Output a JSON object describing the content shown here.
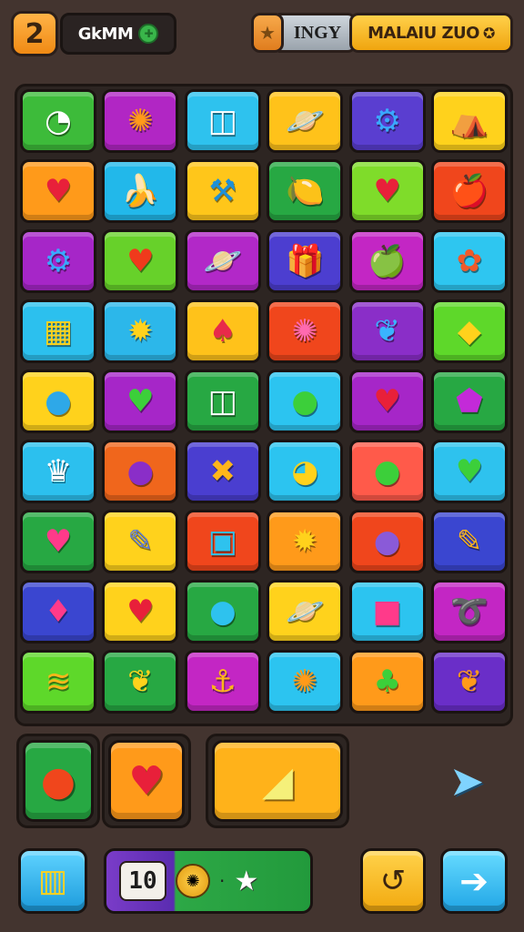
{
  "header": {
    "level": "2",
    "player_name": "GkMM",
    "tag": "INGY",
    "score_text": "MALAIU ZUO"
  },
  "board": {
    "rows": 9,
    "columns": 6,
    "tiles": [
      [
        {
          "color": "#3dbb3a",
          "icon": "pie-timer",
          "glyph": "◔",
          "fg": "#ffffff"
        },
        {
          "color": "#b126c4",
          "icon": "sun-gear",
          "glyph": "✺",
          "fg": "#ff9a1a"
        },
        {
          "color": "#2ec2ee",
          "icon": "cake-drum",
          "glyph": "◫",
          "fg": "#ffffff"
        },
        {
          "color": "#ffc21a",
          "icon": "planet",
          "glyph": "🪐",
          "fg": "#6b5cff"
        },
        {
          "color": "#5a3ed0",
          "icon": "blue-gear",
          "glyph": "⚙",
          "fg": "#3aa8ff"
        },
        {
          "color": "#ffd21c",
          "icon": "tent",
          "glyph": "⛺",
          "fg": "#2a6b9a"
        }
      ],
      [
        {
          "color": "#ff9a1a",
          "icon": "red-heart",
          "glyph": "♥",
          "fg": "#e8203a"
        },
        {
          "color": "#22b8ea",
          "icon": "banana",
          "glyph": "🍌",
          "fg": "#ffd21c"
        },
        {
          "color": "#ffc61a",
          "icon": "wrench",
          "glyph": "⚒",
          "fg": "#1e90d8"
        },
        {
          "color": "#27a843",
          "icon": "lemon",
          "glyph": "🍋",
          "fg": "#ffd21c"
        },
        {
          "color": "#7fdc2a",
          "icon": "strawberry",
          "glyph": "♥",
          "fg": "#e8203a"
        },
        {
          "color": "#f0461c",
          "icon": "apple",
          "glyph": "🍎",
          "fg": "#e8203a"
        }
      ],
      [
        {
          "color": "#a626c8",
          "icon": "blue-gear",
          "glyph": "⚙",
          "fg": "#3aa8ff"
        },
        {
          "color": "#67d12a",
          "icon": "heart",
          "glyph": "♥",
          "fg": "#f03a1c"
        },
        {
          "color": "#b228c8",
          "icon": "planet",
          "glyph": "🪐",
          "fg": "#4ac4ff"
        },
        {
          "color": "#4c3ed0",
          "icon": "gift-box",
          "glyph": "🎁",
          "fg": "#ff7a2a"
        },
        {
          "color": "#c326c4",
          "icon": "apple",
          "glyph": "🍏",
          "fg": "#ffe23a"
        },
        {
          "color": "#2ec6f0",
          "icon": "maple-leaf",
          "glyph": "✿",
          "fg": "#f05a2a"
        }
      ],
      [
        {
          "color": "#2cc0ee",
          "icon": "building",
          "glyph": "▦",
          "fg": "#ffd21c"
        },
        {
          "color": "#2cb7ea",
          "icon": "star-flower",
          "glyph": "✹",
          "fg": "#ffd21c"
        },
        {
          "color": "#ffc21a",
          "icon": "radish",
          "glyph": "♠",
          "fg": "#e82a4a"
        },
        {
          "color": "#f0461c",
          "icon": "crab",
          "glyph": "✺",
          "fg": "#ff6ab0"
        },
        {
          "color": "#8a2ec8",
          "icon": "leaf",
          "glyph": "❦",
          "fg": "#3ab4ff"
        },
        {
          "color": "#5ed82a",
          "icon": "cheese",
          "glyph": "◆",
          "fg": "#ffd21c"
        }
      ],
      [
        {
          "color": "#ffd21c",
          "icon": "rainbow-ball",
          "glyph": "●",
          "fg": "#2ea8e8"
        },
        {
          "color": "#a626c8",
          "icon": "green-heart",
          "glyph": "♥",
          "fg": "#3ccf3a"
        },
        {
          "color": "#27a843",
          "icon": "drum",
          "glyph": "◫",
          "fg": "#ffffff"
        },
        {
          "color": "#2cc4f0",
          "icon": "lime",
          "glyph": "●",
          "fg": "#3ccf3a"
        },
        {
          "color": "#a626c8",
          "icon": "red-apple",
          "glyph": "♥",
          "fg": "#e8203a"
        },
        {
          "color": "#27a843",
          "icon": "gem-shield",
          "glyph": "⬟",
          "fg": "#c32ad8"
        }
      ],
      [
        {
          "color": "#2cc0ee",
          "icon": "cake",
          "glyph": "♛",
          "fg": "#ffffff"
        },
        {
          "color": "#f0661c",
          "icon": "plum",
          "glyph": "●",
          "fg": "#8a2ec8"
        },
        {
          "color": "#4a3ed0",
          "icon": "crossed-x",
          "glyph": "✖",
          "fg": "#ffb61a"
        },
        {
          "color": "#2cc4f0",
          "icon": "lemon",
          "glyph": "◕",
          "fg": "#ffd21c"
        },
        {
          "color": "#ff5a4a",
          "icon": "avocado",
          "glyph": "●",
          "fg": "#3ccf3a"
        },
        {
          "color": "#2ec2ee",
          "icon": "green-heart",
          "glyph": "♥",
          "fg": "#3ccf3a"
        }
      ],
      [
        {
          "color": "#27a843",
          "icon": "pink-heart",
          "glyph": "♥",
          "fg": "#ff3a8a"
        },
        {
          "color": "#ffd21c",
          "icon": "pencil",
          "glyph": "✎",
          "fg": "#5a7ad8"
        },
        {
          "color": "#f0461c",
          "icon": "monitor",
          "glyph": "▣",
          "fg": "#2ec2ee"
        },
        {
          "color": "#ff9a1a",
          "icon": "sun-flower",
          "glyph": "✹",
          "fg": "#ffd21c"
        },
        {
          "color": "#f0461c",
          "icon": "striped-ball",
          "glyph": "●",
          "fg": "#8a5ad8"
        },
        {
          "color": "#3a46d0",
          "icon": "pencil",
          "glyph": "✎",
          "fg": "#ffb61a"
        }
      ],
      [
        {
          "color": "#3a46d0",
          "icon": "pink-gem",
          "glyph": "♦",
          "fg": "#ff3a8a"
        },
        {
          "color": "#ffd21c",
          "icon": "red-heart",
          "glyph": "♥",
          "fg": "#e8203a"
        },
        {
          "color": "#27a843",
          "icon": "bomb-drop",
          "glyph": "●",
          "fg": "#2ec2ee"
        },
        {
          "color": "#ffd21c",
          "icon": "planet",
          "glyph": "🪐",
          "fg": "#ff9a1a"
        },
        {
          "color": "#2cc4f0",
          "icon": "box",
          "glyph": "■",
          "fg": "#ff3a8a"
        },
        {
          "color": "#c326c4",
          "icon": "bow",
          "glyph": "➰",
          "fg": "#ffd21c"
        }
      ],
      [
        {
          "color": "#5ed82a",
          "icon": "coil",
          "glyph": "≋",
          "fg": "#ffb61a"
        },
        {
          "color": "#27a843",
          "icon": "lemon",
          "glyph": "❦",
          "fg": "#ffd21c"
        },
        {
          "color": "#c326c4",
          "icon": "anchor",
          "glyph": "⚓",
          "fg": "#ffb61a"
        },
        {
          "color": "#2cc4f0",
          "icon": "cookie",
          "glyph": "✺",
          "fg": "#ff9a1a"
        },
        {
          "color": "#ff9a1a",
          "icon": "leaf",
          "glyph": "♣",
          "fg": "#3ccf3a"
        },
        {
          "color": "#6a2ec8",
          "icon": "rainbow-leaf",
          "glyph": "❦",
          "fg": "#ff9a1a"
        }
      ]
    ]
  },
  "tray": {
    "slots": [
      {
        "color": "#27a843",
        "icon": "tomato",
        "glyph": "●",
        "fg": "#f0461c"
      },
      {
        "color": "#ff9a1a",
        "icon": "big-heart",
        "glyph": "♥",
        "fg": "#e8203a"
      },
      {
        "color": "#ffb21a",
        "icon": "cheese-wedge",
        "glyph": "◢",
        "fg": "#f5f07a"
      }
    ]
  },
  "footer": {
    "combo_number": "10",
    "combo_coin": "✺",
    "combo_separator": "·",
    "combo_star": "★",
    "map_glyph": "▥",
    "undo_glyph": "↺",
    "next_glyph": "➔",
    "send_glyph": "➤"
  }
}
